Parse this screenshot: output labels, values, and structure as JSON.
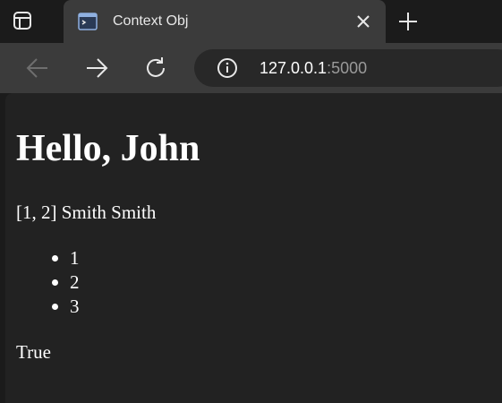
{
  "tab": {
    "title": "Context Obj"
  },
  "omnibox": {
    "host": "127.0.0.1",
    "port": ":5000"
  },
  "page": {
    "heading": "Hello, John",
    "context_line": "[1, 2] Smith Smith",
    "items": [
      "1",
      "2",
      "3"
    ],
    "flag": "True"
  },
  "icons": {
    "tab_actions": "tab-actions-icon",
    "favicon": "terminal-icon",
    "close": "close-icon",
    "new_tab": "plus-icon",
    "back": "arrow-left-icon",
    "forward": "arrow-right-icon",
    "reload": "reload-icon",
    "site_info": "info-icon"
  },
  "colors": {
    "chrome_dark": "#1b1b1b",
    "chrome_tab": "#3b3b3b",
    "omnibox": "#282828",
    "page_bg": "#222222",
    "text": "#ffffff"
  }
}
